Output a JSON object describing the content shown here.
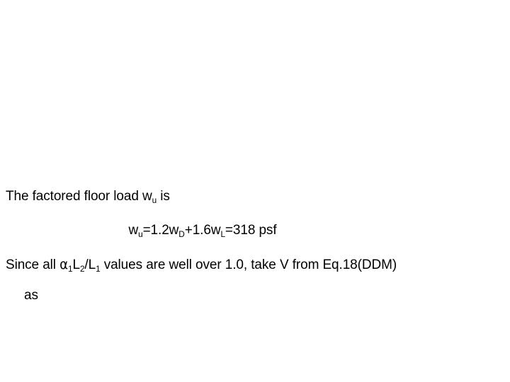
{
  "slide": {
    "background_color": "#ffffff",
    "text_color": "#000000",
    "lines": [
      {
        "id": "intro",
        "align": "left",
        "text": "The factored floor load wu is",
        "segments": [
          {
            "t": "The factored floor load ",
            "kind": "plain"
          },
          {
            "t": "w",
            "kind": "var"
          },
          {
            "t": "u",
            "kind": "sub"
          },
          {
            "t": " is",
            "kind": "plain"
          }
        ]
      },
      {
        "id": "equation",
        "align": "center",
        "text": "wu=1.2wD+1.6wL=318 psf",
        "segments": [
          {
            "t": "w",
            "kind": "var"
          },
          {
            "t": "u",
            "kind": "sub"
          },
          {
            "t": "=1.2",
            "kind": "plain"
          },
          {
            "t": "w",
            "kind": "var"
          },
          {
            "t": "D",
            "kind": "sub"
          },
          {
            "t": "+1.6",
            "kind": "plain"
          },
          {
            "t": "w",
            "kind": "var"
          },
          {
            "t": "L",
            "kind": "sub"
          },
          {
            "t": "=318 psf",
            "kind": "plain"
          }
        ]
      },
      {
        "id": "since",
        "align": "left",
        "text": "Since all α1L2/L1 values are well over 1.0, take V from Eq.18(DDM)",
        "segments": [
          {
            "t": "Since all ",
            "kind": "plain"
          },
          {
            "t": "α",
            "kind": "greek"
          },
          {
            "t": "1",
            "kind": "sub"
          },
          {
            "t": "L",
            "kind": "var"
          },
          {
            "t": "2",
            "kind": "sub"
          },
          {
            "t": "/",
            "kind": "plain"
          },
          {
            "t": "L",
            "kind": "var"
          },
          {
            "t": "1",
            "kind": "sub"
          },
          {
            "t": " values are well over 1.0, take V from Eq.18(DDM)",
            "kind": "plain"
          }
        ]
      },
      {
        "id": "as",
        "align": "left",
        "text": "as",
        "segments": [
          {
            "t": "as",
            "kind": "plain"
          }
        ]
      }
    ]
  },
  "text": {
    "intro_prefix": "The factored floor load ",
    "intro_var": "w",
    "intro_sub": "u",
    "intro_suffix": " is",
    "eq_var1": "w",
    "eq_sub1": "u",
    "eq_mid1": "=1.2",
    "eq_var2": "w",
    "eq_sub2": "D",
    "eq_mid2": "+1.6",
    "eq_var3": "w",
    "eq_sub3": "L",
    "eq_tail": "=318 psf",
    "since_prefix": "Since all ",
    "since_alpha": "α",
    "since_alpha_sub": "1",
    "since_L2": "L",
    "since_L2_sub": "2",
    "since_slash": "/",
    "since_L1": "L",
    "since_L1_sub": "1",
    "since_suffix": " values are well over 1.0, take V from Eq.18(DDM)",
    "as_text": "as"
  }
}
